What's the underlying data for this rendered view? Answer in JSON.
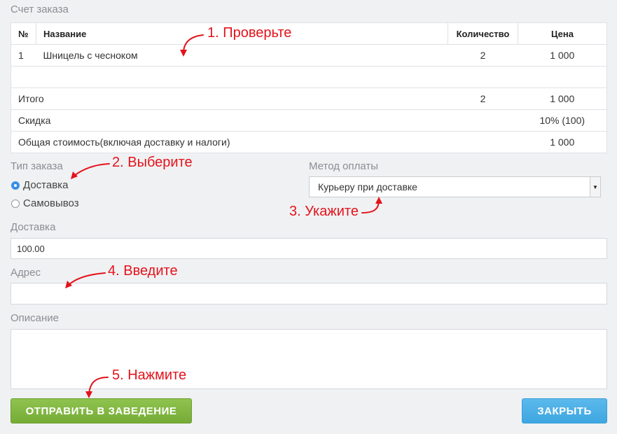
{
  "order_section": {
    "title": "Счет заказа"
  },
  "table": {
    "headers": {
      "num": "№",
      "name": "Название",
      "qty": "Количество",
      "price": "Цена"
    },
    "items": [
      {
        "num": "1",
        "name": "Шницель с чесноком",
        "qty": "2",
        "price": "1 000"
      }
    ],
    "total": {
      "label": "Итого",
      "qty": "2",
      "price": "1 000"
    },
    "discount": {
      "label": "Скидка",
      "value": "10% (100)"
    },
    "grand_total": {
      "label": "Общая стоимость(включая доставку и налоги)",
      "value": "1 000"
    }
  },
  "order_type": {
    "label": "Тип заказа",
    "options": [
      {
        "label": "Доставка",
        "checked": true
      },
      {
        "label": "Самовывоз",
        "checked": false
      }
    ]
  },
  "payment": {
    "label": "Метод оплаты",
    "selected": "Курьеру при доставке"
  },
  "delivery": {
    "label": "Доставка",
    "value": "100.00"
  },
  "address": {
    "label": "Адрес",
    "value": ""
  },
  "description": {
    "label": "Описание",
    "value": ""
  },
  "buttons": {
    "send": "ОТПРАВИТЬ В ЗАВЕДЕНИЕ",
    "close": "ЗАКРЫТЬ"
  },
  "annotations": {
    "check": "1. Проверьте",
    "choose": "2. Выберите",
    "specify": "3. Укажите",
    "enter": "4. Введите",
    "press": "5. Нажмите"
  },
  "colors": {
    "annotation": "#e3131b",
    "send_button": "#7cb53d",
    "close_button": "#46aae3",
    "radio_accent": "#3a8ee6"
  }
}
